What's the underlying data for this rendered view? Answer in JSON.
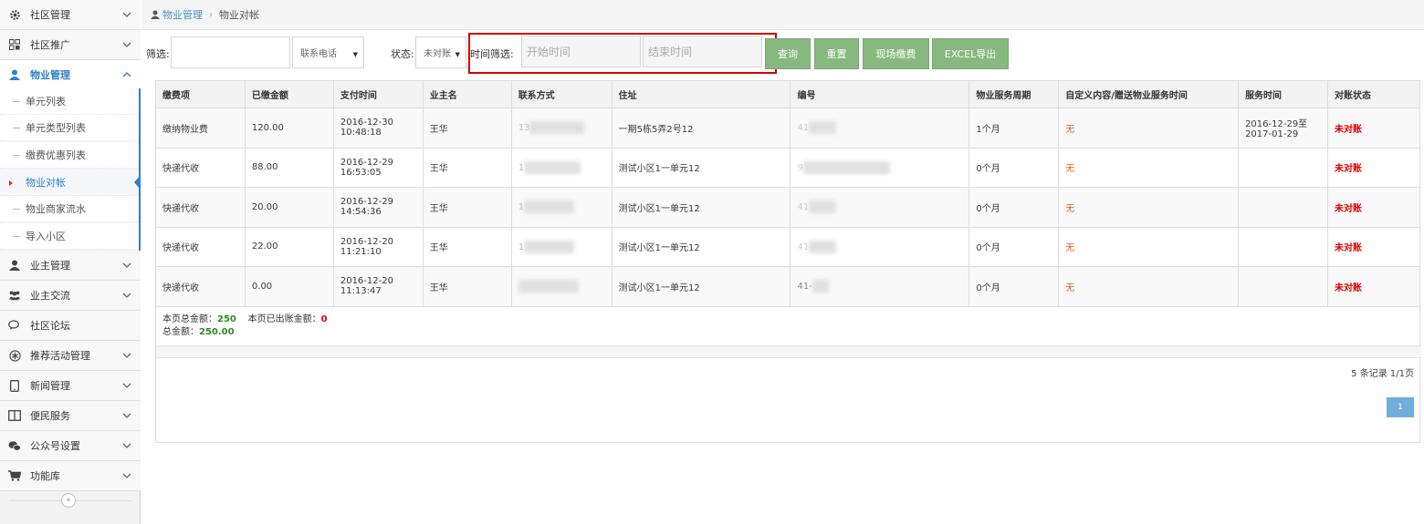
{
  "sidebar": {
    "items": [
      {
        "label": "社区管理",
        "icon": "gear-icon"
      },
      {
        "label": "社区推广",
        "icon": "grid-icon"
      },
      {
        "label": "物业管理",
        "icon": "user-icon"
      },
      {
        "label": "业主管理",
        "icon": "user-icon"
      },
      {
        "label": "业主交流",
        "icon": "users-icon"
      },
      {
        "label": "社区论坛",
        "icon": "chat-icon"
      },
      {
        "label": "推荐活动管理",
        "icon": "asterisk-icon"
      },
      {
        "label": "新闻管理",
        "icon": "tablet-icon"
      },
      {
        "label": "便民服务",
        "icon": "columns-icon"
      },
      {
        "label": "公众号设置",
        "icon": "wechat-icon"
      },
      {
        "label": "功能库",
        "icon": "cart-icon"
      }
    ],
    "submenu": [
      {
        "label": "单元列表"
      },
      {
        "label": "单元类型列表"
      },
      {
        "label": "缴费优惠列表"
      },
      {
        "label": "物业对帐"
      },
      {
        "label": "物业商家流水"
      },
      {
        "label": "导入小区"
      }
    ],
    "collapse_symbol": "«"
  },
  "breadcrumb": {
    "parent": "物业管理",
    "current": "物业对帐"
  },
  "filters": {
    "filter_label": "筛选:",
    "filter_value": "",
    "field_select": "联系电话",
    "status_label": "状态:",
    "status_select": "未对账",
    "time_label": "时间筛选:",
    "start_placeholder": "开始时间",
    "end_placeholder": "结束时间",
    "buttons": {
      "query": "查询",
      "reset": "重置",
      "onsite": "现场缴费",
      "export": "EXCEL导出"
    }
  },
  "table": {
    "headers": [
      "缴费项",
      "已缴金额",
      "支付时间",
      "业主名",
      "联系方式",
      "住址",
      "编号",
      "物业服务周期",
      "自定义内容/赠送物业服务时间",
      "服务时间",
      "对账状态"
    ],
    "rows": [
      {
        "item": "缴纳物业费",
        "amount": "120.00",
        "date": "2016-12-30",
        "time": "10:48:18",
        "owner": "王华",
        "phone_hint": "13",
        "address": "一期5栋5弄2号12",
        "code_hint": "41",
        "period": "1个月",
        "custom": "无",
        "service_start": "2016-12-29至",
        "service_end": "2017-01-29",
        "status": "未对账"
      },
      {
        "item": "快递代收",
        "amount": "88.00",
        "date": "2016-12-29",
        "time": "16:53:05",
        "owner": "王华",
        "phone_hint": "1",
        "address": "测试小区1一单元12",
        "code_hint": "9",
        "period": "0个月",
        "custom": "无",
        "service_start": "",
        "service_end": "",
        "status": "未对账"
      },
      {
        "item": "快递代收",
        "amount": "20.00",
        "date": "2016-12-29",
        "time": "14:54:36",
        "owner": "王华",
        "phone_hint": "1",
        "address": "测试小区1一单元12",
        "code_hint": "41",
        "period": "0个月",
        "custom": "无",
        "service_start": "",
        "service_end": "",
        "status": "未对账"
      },
      {
        "item": "快递代收",
        "amount": "22.00",
        "date": "2016-12-20",
        "time": "11:21:10",
        "owner": "王华",
        "phone_hint": "1",
        "address": "测试小区1一单元12",
        "code_hint": "41",
        "period": "0个月",
        "custom": "无",
        "service_start": "",
        "service_end": "",
        "status": "未对账"
      },
      {
        "item": "快递代收",
        "amount": "0.00",
        "date": "2016-12-20",
        "time": "11:13:47",
        "owner": "王华",
        "phone_hint": "",
        "address": "测试小区1一单元12",
        "code_hint": "41-",
        "period": "0个月",
        "custom": "无",
        "service_start": "",
        "service_end": "",
        "status": "未对账"
      }
    ]
  },
  "summary": {
    "page_total_label": "本页总金额：",
    "page_total": "250",
    "page_billed_label": "本页已出账金额：",
    "page_billed": "0",
    "total_label": "总金额：",
    "total": "250.00"
  },
  "pagination": {
    "records": "5 条记录 1/1页",
    "current_page": "1"
  },
  "colors": {
    "accent": "#307ecc",
    "button_green": "#87b87f",
    "status_red": "#dd0000",
    "highlight_red": "#d40000"
  }
}
